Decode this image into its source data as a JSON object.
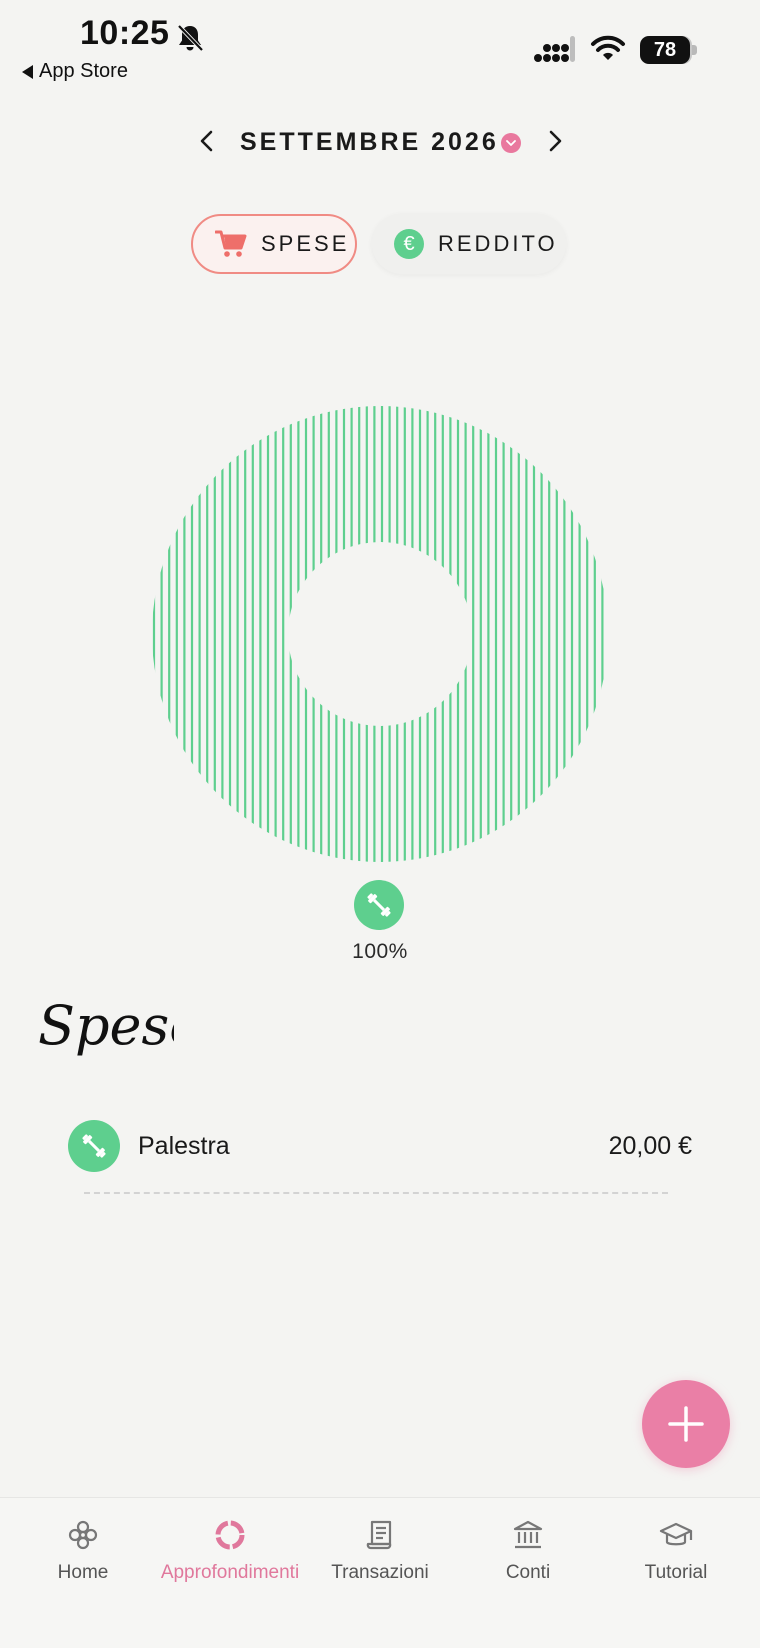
{
  "status_bar": {
    "time": "10:25",
    "back_label": "App Store",
    "battery": "78"
  },
  "header": {
    "month": "SETTEMBRE 2026"
  },
  "segments": {
    "expenses_label": "SPESE",
    "income_label": "REDDITO",
    "income_symbol": "€",
    "selected": "SPESE"
  },
  "chart_data": {
    "type": "pie",
    "categories": [
      "Palestra"
    ],
    "values": [
      100
    ],
    "colors": [
      "#5ecf8e"
    ]
  },
  "category_summary": {
    "icon": "dumbbell-icon",
    "percent_label": "100%"
  },
  "section": {
    "title": "Spese"
  },
  "expenses": [
    {
      "name": "Palestra",
      "amount": "20,00 €",
      "icon": "dumbbell-icon",
      "color": "#5ecf8e"
    }
  ],
  "tabs": [
    {
      "label": "Home",
      "icon": "flower-icon"
    },
    {
      "label": "Approfondimenti",
      "icon": "donut-icon",
      "active": true
    },
    {
      "label": "Transazioni",
      "icon": "receipt-icon"
    },
    {
      "label": "Conti",
      "icon": "bank-icon"
    },
    {
      "label": "Tutorial",
      "icon": "graduation-cap-icon"
    }
  ],
  "colors": {
    "accent_pink": "#ea7fa6",
    "accent_green": "#5ecf8e",
    "expenses_border": "#f08b84"
  }
}
